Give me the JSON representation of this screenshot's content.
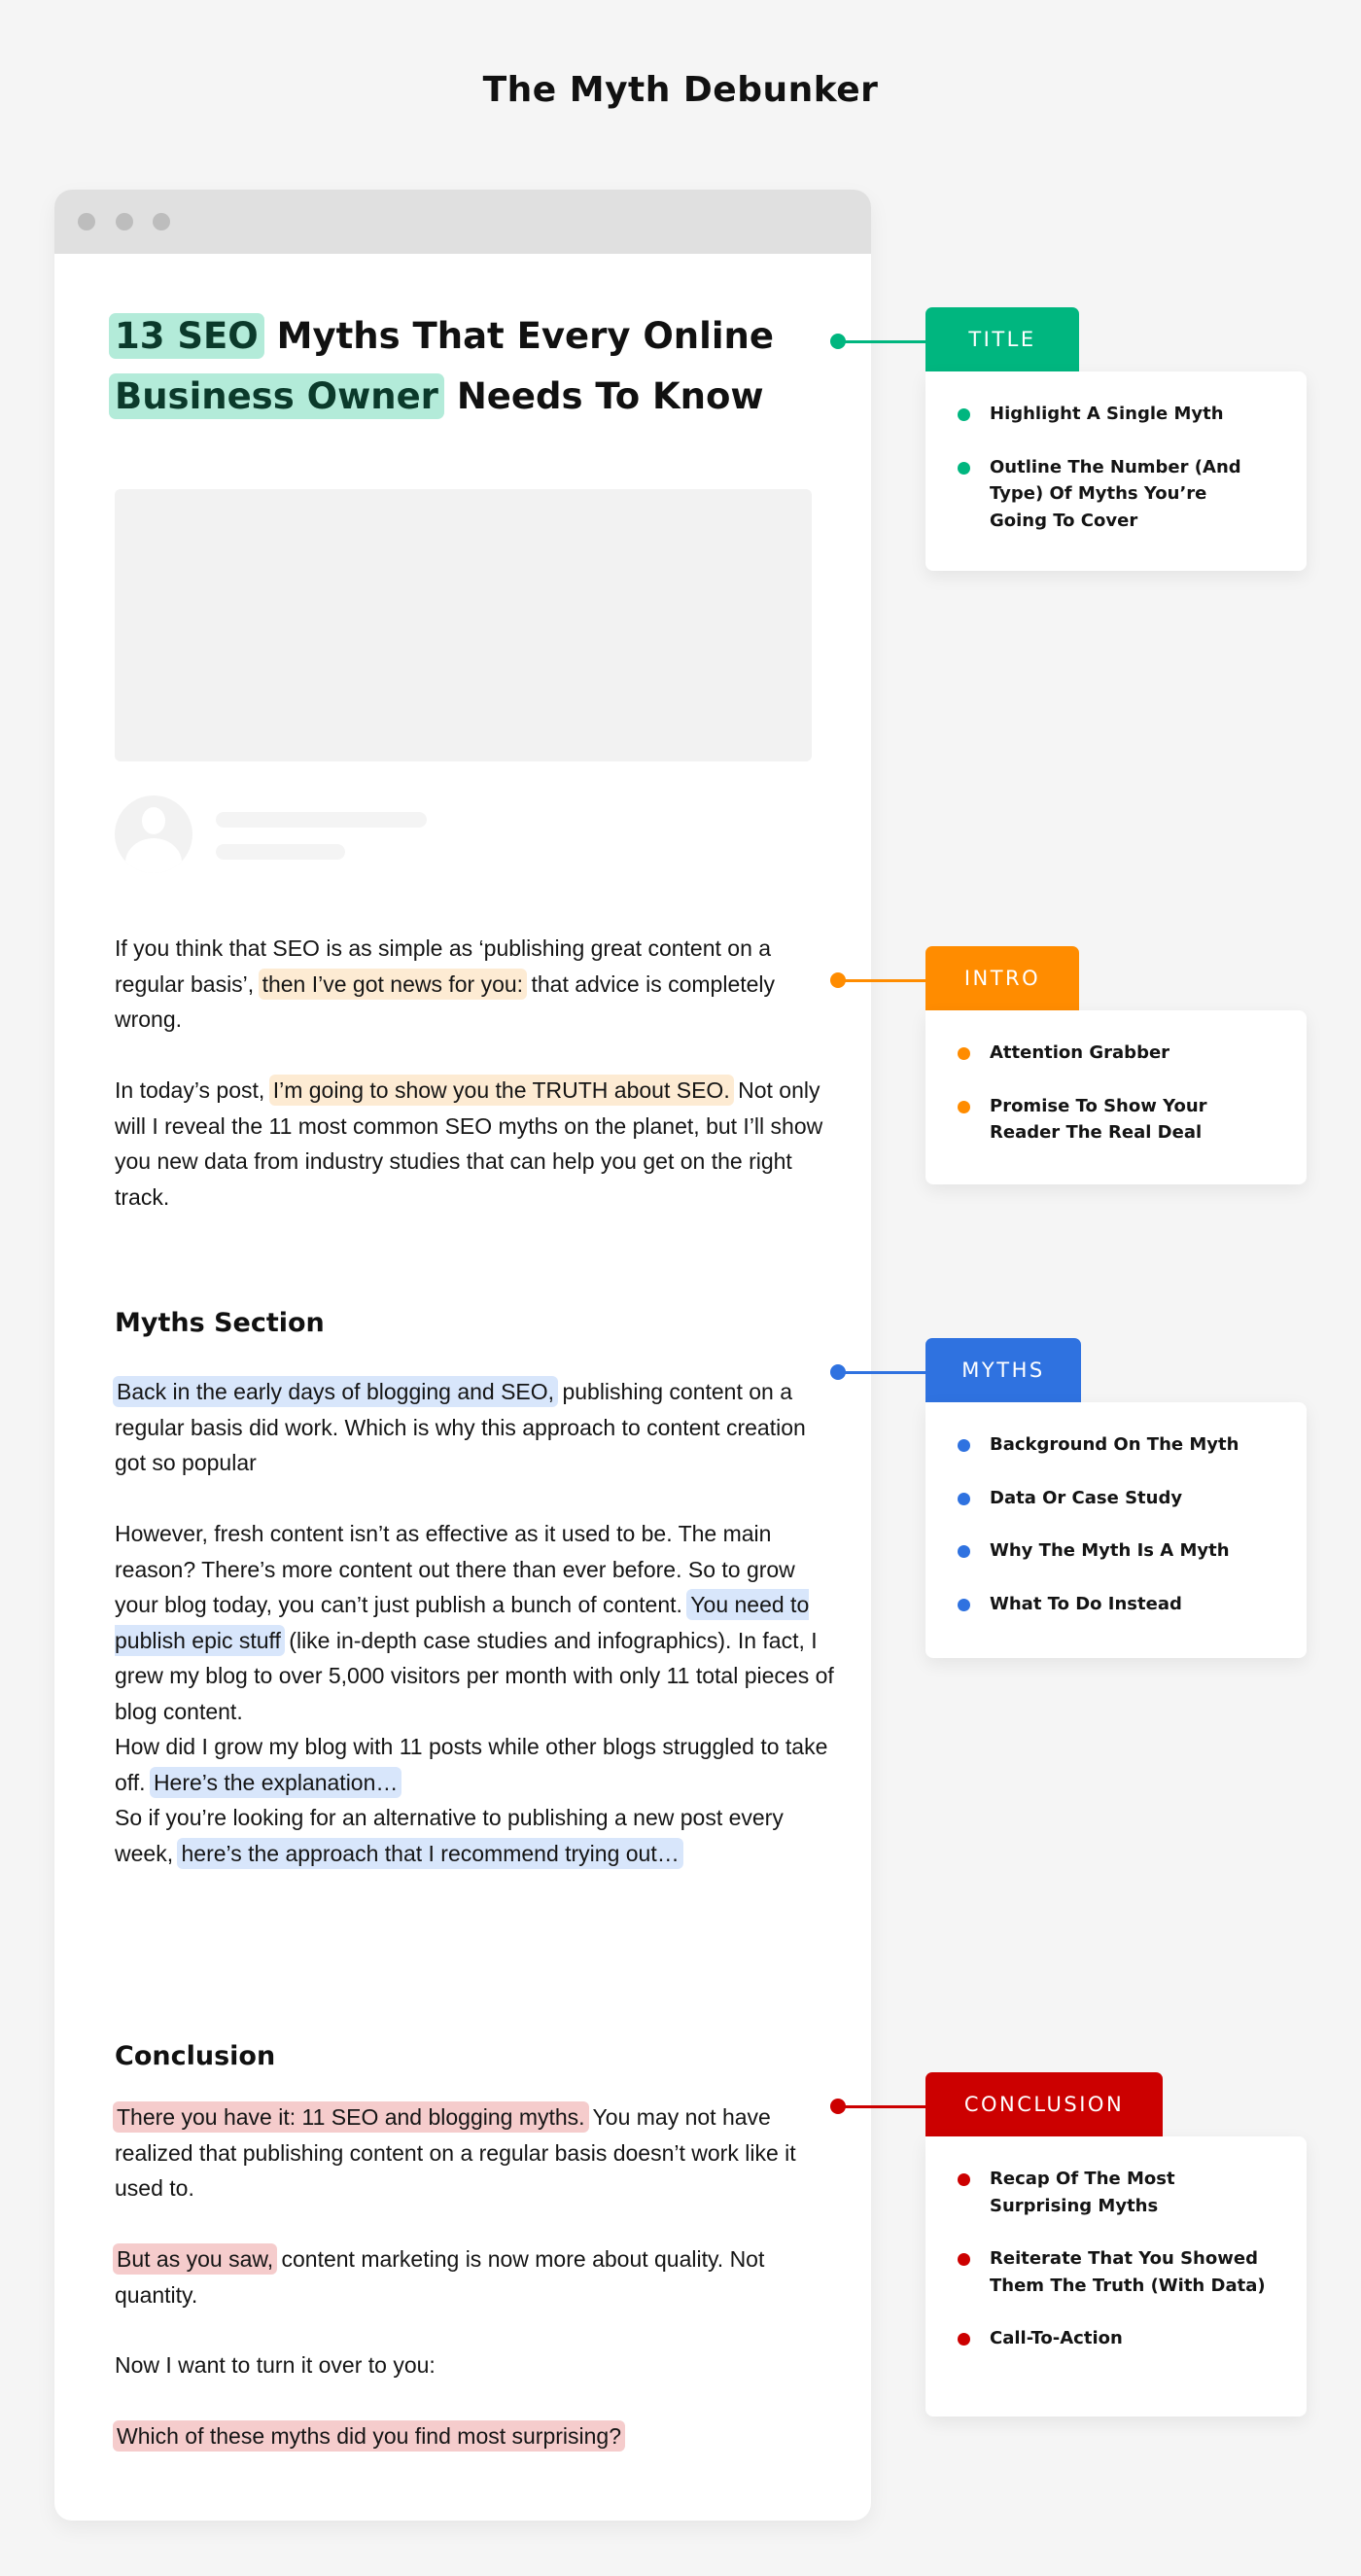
{
  "page": {
    "title": "The Myth Debunker"
  },
  "colors": {
    "title": "#00b67f",
    "intro": "#ff8c00",
    "myths": "#2f72e0",
    "conclusion": "#cc0000",
    "highlight_green": "#b3ebd9",
    "highlight_orange": "#fdebd3",
    "highlight_blue": "#d8e6fb",
    "highlight_red": "#f5cccc"
  },
  "article": {
    "headline": {
      "hl1": "13 SEO",
      "t1": " Myths That Every Online",
      "hl2": "Business Owner",
      "t2": " Needs To Know"
    },
    "intro": {
      "p1": {
        "a": "If you think that SEO is as simple as ‘publishing great content on a regular basis’,",
        "hl": "then I’ve got news for you:",
        "b": " that advice is completely wrong."
      },
      "p2": {
        "a": "In today’s post,",
        "hl": "I’m going to show you the TRUTH about SEO.",
        "b": " Not only will I reveal the 11 most common SEO myths on the planet, but I’ll show you new data from industry studies that can help you get on the right track."
      }
    },
    "myths": {
      "heading": "Myths Section",
      "p1": {
        "hl": "Back in the early days of blogging and SEO,",
        "b": " publishing content on a regular basis did work. Which is why this approach to content creation got so popular"
      },
      "p2": {
        "a": "However, fresh content isn’t as effective as it used to be. The main reason? There’s more content out there than ever before. So to grow your blog today, you can’t just publish a bunch of content.",
        "hl": "You need to publish epic stuff",
        "b": " (like in-depth case studies and infographics). In fact, I grew my blog to over 5,000 visitors per month with only 11 total pieces of blog content."
      },
      "p3": {
        "a": "How did I grow my blog with 11 posts while other blogs struggled to take off.",
        "hl": "Here’s the explanation…"
      },
      "p4": {
        "a": "So if you’re looking for an alternative to publishing a new post every week,",
        "hl": "here’s the approach that I recommend trying out…"
      }
    },
    "conclusion": {
      "heading": "Conclusion",
      "p1": {
        "hl": "There you have it: 11 SEO and blogging myths.",
        "b": " You may not have realized that publishing content on a regular basis doesn’t work like it used to."
      },
      "p2": {
        "hl": "But as you saw,",
        "b": " content marketing is now more about quality. Not quantity."
      },
      "p3": {
        "a": "Now I want to turn it over to you:"
      },
      "p4": {
        "hl": "Which of these myths did you find most surprising?"
      }
    }
  },
  "annotations": {
    "title": {
      "label": "TITLE",
      "items": [
        "Highlight A Single Myth",
        "Outline The Number (And Type) Of Myths You’re Going To Cover"
      ]
    },
    "intro": {
      "label": "INTRO",
      "items": [
        "Attention Grabber",
        "Promise To Show Your Reader The Real Deal"
      ]
    },
    "myths": {
      "label": "MYTHS",
      "items": [
        "Background On The Myth",
        "Data Or Case Study",
        "Why The Myth Is A Myth",
        "What To Do Instead"
      ]
    },
    "conclusion": {
      "label": "CONCLUSION",
      "items": [
        "Recap Of The Most Surprising Myths",
        "Reiterate That You Showed Them The Truth (With Data)",
        "Call-To-Action"
      ]
    }
  }
}
